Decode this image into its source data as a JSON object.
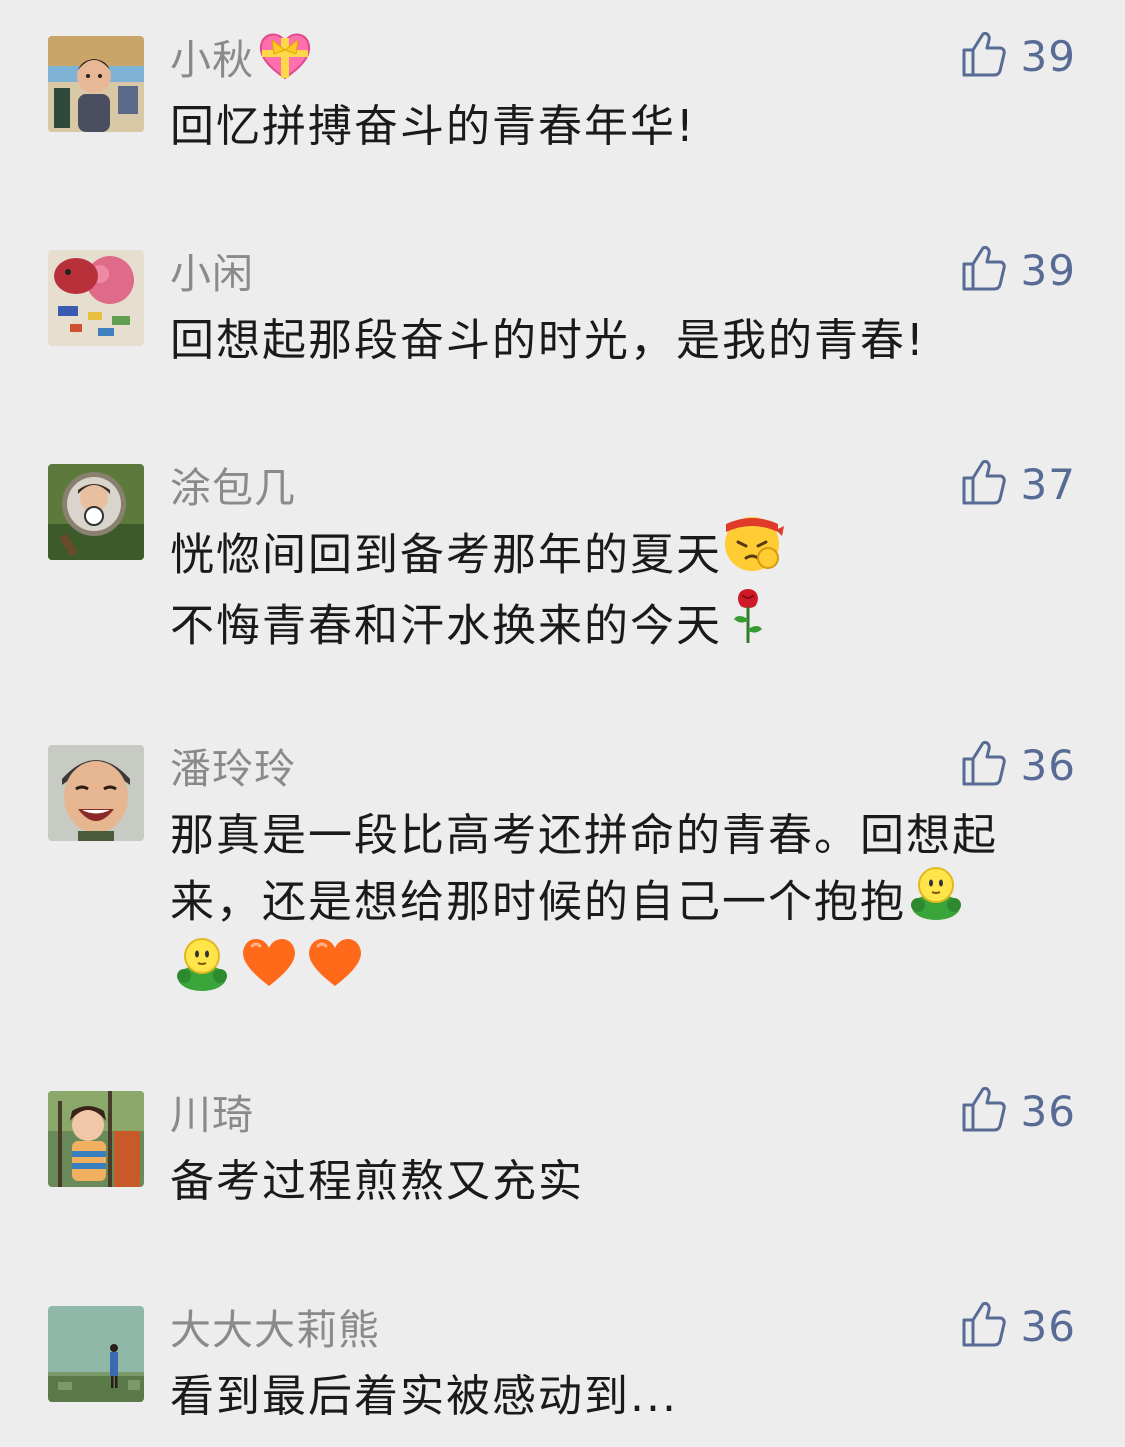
{
  "comments": [
    {
      "name": "小秋",
      "name_emoji": "gift-heart-emoji",
      "likes": "39",
      "lines": [
        "回忆拼搏奋斗的青春年华!"
      ],
      "avatar": "child-beach-photo"
    },
    {
      "name": "小闲",
      "likes": "39",
      "lines": [
        "回想起那段奋斗的时光，是我的青春!"
      ],
      "avatar": "toys-photo"
    },
    {
      "name": "涂包几",
      "likes": "37",
      "lines": [
        "恍惚间回到备考那年的夏天",
        "不悔青春和汗水换来的今天"
      ],
      "line_emojis": [
        "determined-face-emoji",
        "rose-emoji"
      ],
      "avatar": "child-magnifier-photo"
    },
    {
      "name": "潘玲玲",
      "likes": "36",
      "lines": [
        "那真是一段比高考还拼命的青春。回想起",
        "来，还是想给那时候的自己一个抱抱"
      ],
      "line_emojis": [
        "hug-emoji",
        "hug-emoji heart-emoji heart-emoji"
      ],
      "avatar": "laughing-boy-photo"
    },
    {
      "name": "川琦",
      "likes": "36",
      "lines": [
        "备考过程煎熬又充实"
      ],
      "avatar": "girl-garden-photo"
    },
    {
      "name": "大大大莉熊",
      "likes": "36",
      "lines": [
        "看到最后着实被感动到..."
      ],
      "avatar": "person-wall-photo"
    }
  ],
  "colors": {
    "background": "#ededed",
    "name": "#8a8a8a",
    "like": "#576b95",
    "text": "#1a1a1a"
  }
}
